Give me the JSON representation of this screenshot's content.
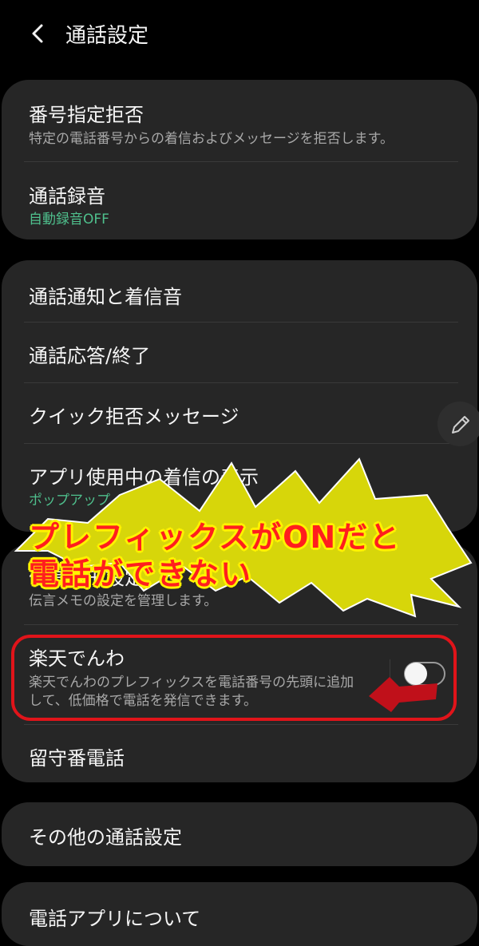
{
  "header": {
    "title": "通話設定"
  },
  "card1": {
    "items": [
      {
        "label": "番号指定拒否",
        "sub": "特定の電話番号からの着信およびメッセージを拒否します。"
      },
      {
        "label": "通話録音",
        "sub": "自動録音OFF"
      }
    ]
  },
  "card2": {
    "items": [
      {
        "label": "通話通知と着信音"
      },
      {
        "label": "通話応答/終了"
      },
      {
        "label": "クイック拒否メッセージ"
      },
      {
        "label": "アプリ使用中の着信の表示",
        "sub": "ポップアップ"
      }
    ]
  },
  "card3": {
    "items": [
      {
        "label": "伝言メモ設定",
        "sub": "伝言メモの設定を管理します。"
      },
      {
        "label": "楽天でんわ",
        "sub_line1": "楽天でんわのプレフィックスを電話番号の先頭に追加",
        "sub_line2": "して、低価格で電話を発信できます。",
        "toggle_on": false
      },
      {
        "label": "留守番電話"
      }
    ]
  },
  "card4": {
    "items": [
      {
        "label": "その他の通話設定"
      }
    ]
  },
  "card5": {
    "items": [
      {
        "label": "電話アプリについて"
      }
    ]
  },
  "annotation": {
    "line1": "プレフィックスがONだと",
    "line2": "電話ができない"
  },
  "colors": {
    "background": "#000000",
    "card": "#262626",
    "accent_green": "#4fc08d",
    "annotation_red": "#e0141a",
    "annotation_yellow": "#d7d60a"
  },
  "icons": {
    "back": "chevron-left-icon",
    "edit": "pencil-icon"
  }
}
